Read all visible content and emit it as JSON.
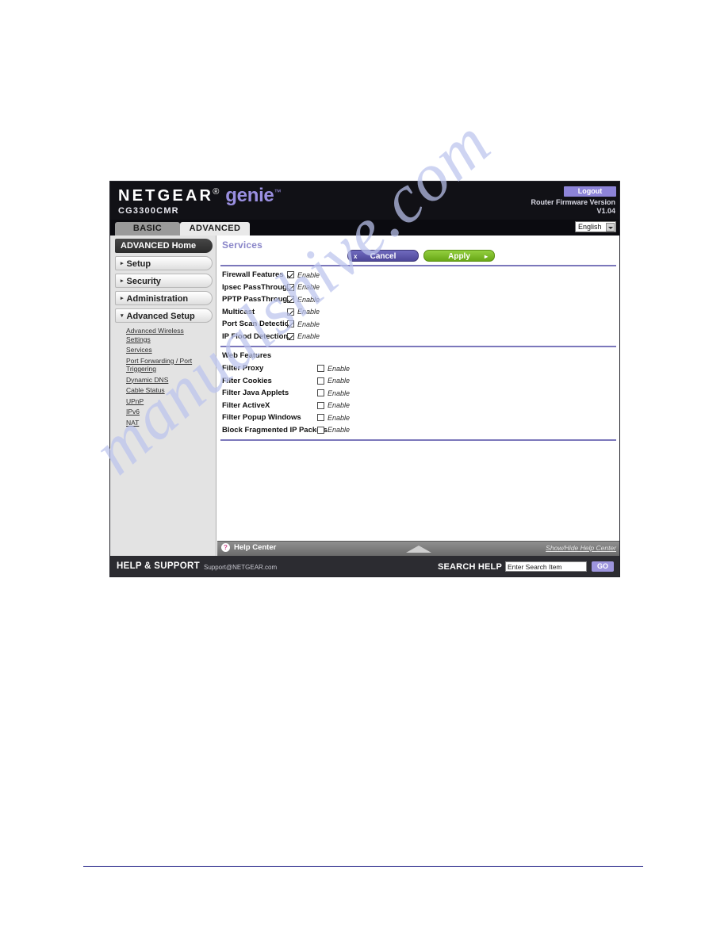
{
  "watermark": {
    "text": "manualshive.com"
  },
  "header": {
    "brand_primary": "NETGEAR",
    "brand_tm": "®",
    "brand_secondary": "genie",
    "brand_secondary_tm": "™",
    "model": "CG3300CMR",
    "logout_label": "Logout",
    "firmware_label": "Router Firmware Version",
    "firmware_version": "V1.04",
    "language": "English"
  },
  "tabs": [
    {
      "label": "BASIC",
      "active": false
    },
    {
      "label": "ADVANCED",
      "active": true
    }
  ],
  "sidebar": {
    "home_label": "ADVANCED Home",
    "groups": [
      {
        "label": "Setup",
        "caret": "▸",
        "expanded": false
      },
      {
        "label": "Security",
        "caret": "▸",
        "expanded": false
      },
      {
        "label": "Administration",
        "caret": "▸",
        "expanded": false
      },
      {
        "label": "Advanced Setup",
        "caret": "▾",
        "expanded": true
      }
    ],
    "submenu": [
      "Advanced Wireless Settings",
      "Services",
      "Port Forwarding / Port Triggering",
      "Dynamic DNS",
      "Cable Status",
      "UPnP",
      "IPv6",
      "NAT"
    ]
  },
  "main": {
    "title": "Services",
    "cancel_label": "Cancel",
    "cancel_glyph": "x",
    "apply_label": "Apply",
    "apply_glyph": "▸",
    "enable_label": "Enable",
    "firewall_section": {
      "rows": [
        {
          "label": "Firewall Features",
          "checked": true
        },
        {
          "label": "Ipsec PassThrough",
          "checked": true
        },
        {
          "label": "PPTP PassThrough",
          "checked": true
        },
        {
          "label": "Multicast",
          "checked": true
        },
        {
          "label": "Port Scan Detection",
          "checked": true
        },
        {
          "label": "IP Flood Detection",
          "checked": true
        }
      ]
    },
    "web_section": {
      "heading": "Web Features",
      "rows": [
        {
          "label": "Filter Proxy",
          "checked": false
        },
        {
          "label": "Filter Cookies",
          "checked": false
        },
        {
          "label": "Filter Java Applets",
          "checked": false
        },
        {
          "label": "Filter ActiveX",
          "checked": false
        },
        {
          "label": "Filter Popup Windows",
          "checked": false
        },
        {
          "label": "Block Fragmented IP Packets",
          "checked": false
        }
      ]
    }
  },
  "help_bar": {
    "icon_label": "?",
    "label": "Help Center",
    "toggle_label": "Show/Hide Help Center"
  },
  "footer": {
    "title": "HELP & SUPPORT",
    "email": "Support@NETGEAR.com",
    "search_label": "SEARCH HELP",
    "search_value": "Enter Search Item",
    "go_label": "GO"
  },
  "colors": {
    "accent_purple": "#8a86c9",
    "apply_green": "#7ab929",
    "cancel_blue": "#5b55a8",
    "rule_navy": "#12127e"
  }
}
